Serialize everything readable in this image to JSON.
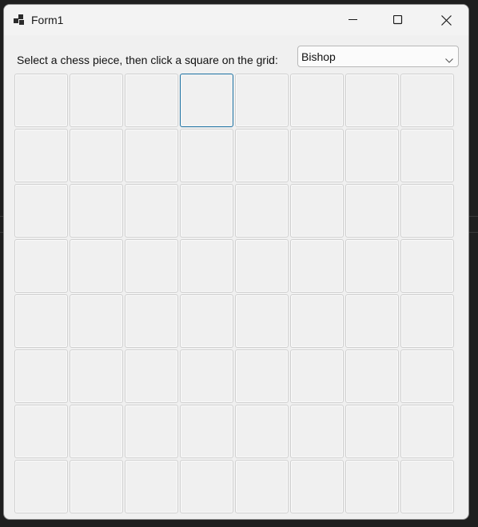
{
  "window": {
    "title": "Form1",
    "icons": {
      "app": "app-grid-icon",
      "minimize": "minimize-icon",
      "maximize": "maximize-icon",
      "close": "close-icon"
    }
  },
  "form": {
    "prompt": "Select a chess piece, then click a square on the grid:",
    "piece_select": {
      "selected": "Bishop",
      "icon": "chevron-down-icon"
    }
  },
  "board": {
    "rows": 8,
    "cols": 8,
    "focused_cell": {
      "row": 1,
      "col": 4
    },
    "accent_color": "#1a6fa0"
  }
}
